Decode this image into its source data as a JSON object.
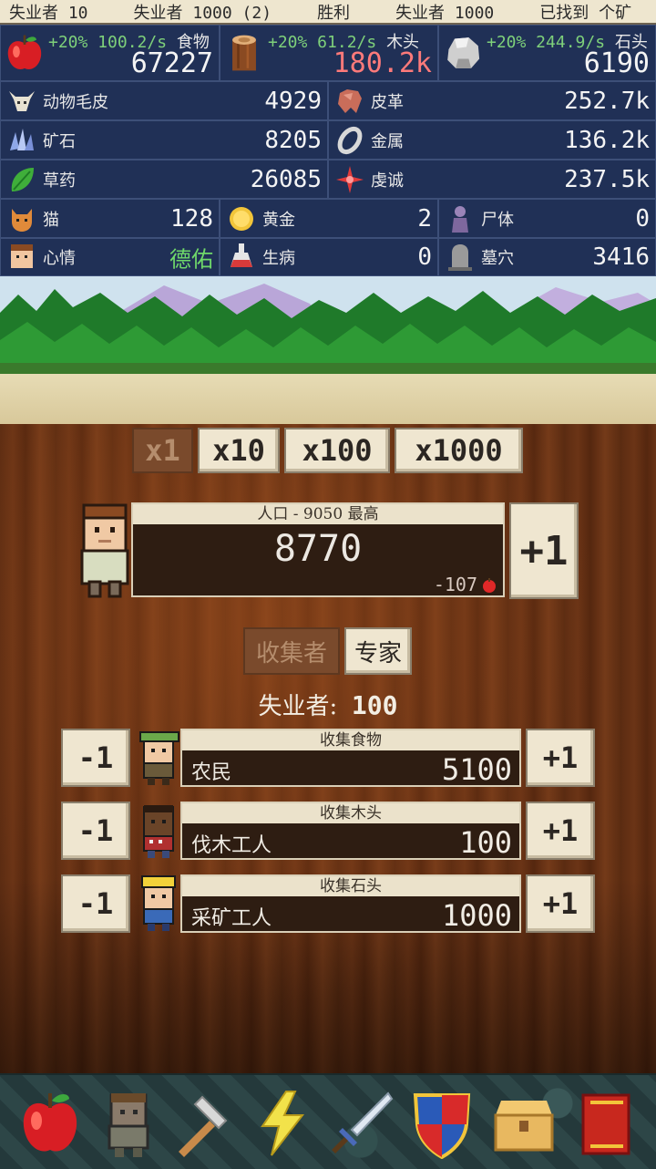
{
  "ticker": [
    "失业者 10",
    "失业者 1000 (2)",
    "胜利",
    "失业者 1000",
    "已找到 个矿"
  ],
  "top": {
    "food": {
      "rate": "+20% 100.2/s",
      "name": "食物",
      "amount": "67227"
    },
    "wood": {
      "rate": "+20% 61.2/s",
      "name": "木头",
      "amount": "180.2k"
    },
    "stone": {
      "rate": "+20% 244.9/s",
      "name": "石头",
      "amount": "6190"
    }
  },
  "res": {
    "fur": {
      "label": "动物毛皮",
      "value": "4929"
    },
    "leather": {
      "label": "皮革",
      "value": "252.7k"
    },
    "ore": {
      "label": "矿石",
      "value": "8205"
    },
    "metal": {
      "label": "金属",
      "value": "136.2k"
    },
    "herbs": {
      "label": "草药",
      "value": "26085"
    },
    "piety": {
      "label": "虔诚",
      "value": "237.5k"
    },
    "cats": {
      "label": "猫",
      "value": "128"
    },
    "gold": {
      "label": "黄金",
      "value": "2"
    },
    "corpses": {
      "label": "尸体",
      "value": "0"
    },
    "mood": {
      "label": "心情",
      "value": "德佑"
    },
    "sick": {
      "label": "生病",
      "value": "0"
    },
    "graves": {
      "label": "墓穴",
      "value": "3416"
    }
  },
  "multipliers": [
    "x1",
    "x10",
    "x100",
    "x1000"
  ],
  "population": {
    "header": "人口 - 9050 最高",
    "value": "8770",
    "delta": "-107",
    "plus": "+1"
  },
  "tabs": {
    "gatherers": "收集者",
    "experts": "专家"
  },
  "idle": {
    "label": "失业者:",
    "value": "100"
  },
  "jobs": [
    {
      "task": "收集食物",
      "name": "农民",
      "count": "5100",
      "minus": "-1",
      "plus": "+1"
    },
    {
      "task": "收集木头",
      "name": "伐木工人",
      "count": "100",
      "minus": "-1",
      "plus": "+1"
    },
    {
      "task": "收集石头",
      "name": "采矿工人",
      "count": "1000",
      "minus": "-1",
      "plus": "+1"
    }
  ],
  "nav": [
    "apple-icon",
    "villager-icon",
    "hammer-icon",
    "lightning-icon",
    "sword-icon",
    "shield-icon",
    "chest-icon",
    "book-icon"
  ]
}
